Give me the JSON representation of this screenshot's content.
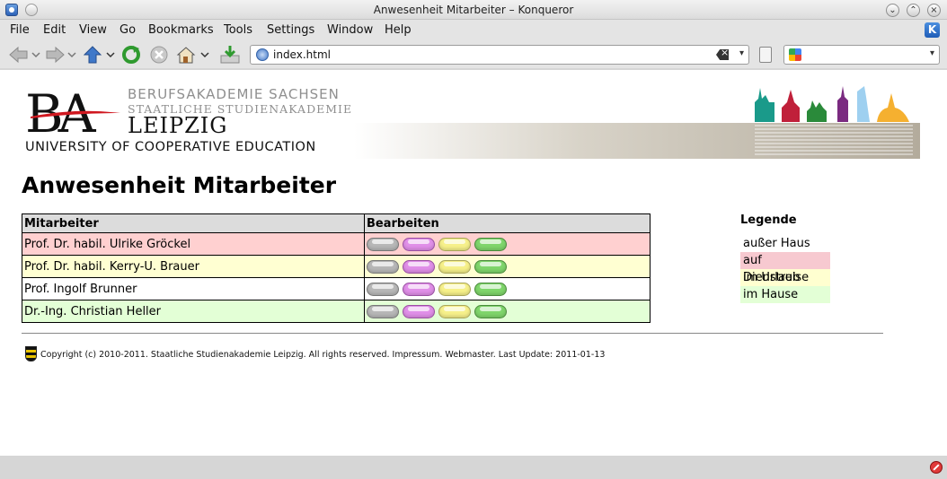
{
  "window": {
    "title": "Anwesenheit Mitarbeiter – Konqueror"
  },
  "menu": [
    {
      "label": "File"
    },
    {
      "label": "Edit"
    },
    {
      "label": "View"
    },
    {
      "label": "Go"
    },
    {
      "label": "Bookmarks"
    },
    {
      "label": "Tools"
    },
    {
      "label": "Settings"
    },
    {
      "label": "Window"
    },
    {
      "label": "Help"
    }
  ],
  "toolbar": {
    "url": "index.html",
    "search_value": "",
    "icons": [
      "back-icon",
      "forward-icon",
      "up-icon",
      "reload-icon",
      "stop-icon",
      "home-icon",
      "download-icon"
    ]
  },
  "banner": {
    "mark": "BA",
    "line1": "BERUFSAKADEMIE SACHSEN",
    "line2": "STAATLICHE STUDIENAKADEMIE",
    "line3": "LEIPZIG",
    "line4": "UNIVERSITY OF COOPERATIVE EDUCATION"
  },
  "page": {
    "title": "Anwesenheit Mitarbeiter",
    "table": {
      "headers": [
        "Mitarbeiter",
        "Bearbeiten"
      ],
      "rows": [
        {
          "name": "Prof. Dr. habil. Ulrike Gröckel",
          "status_color": "#ffd0d0"
        },
        {
          "name": "Prof. Dr. habil. Kerry-U. Brauer",
          "status_color": "#ffffd2"
        },
        {
          "name": "Prof. Ingolf Brunner",
          "status_color": "#ffffff"
        },
        {
          "name": "Dr.-Ing. Christian Heller",
          "status_color": "#e3ffd6"
        }
      ],
      "buttons": [
        "gray",
        "pink",
        "yellow",
        "green"
      ]
    },
    "legend": {
      "title": "Legende",
      "items": [
        {
          "label": "außer Haus",
          "color": "#ffffff"
        },
        {
          "label": "auf Dienstreise",
          "color": "#f7c9d0"
        },
        {
          "label": "im Urlaub",
          "color": "#ffffd0"
        },
        {
          "label": "im Hause",
          "color": "#e3ffd6"
        }
      ]
    },
    "footer": "Copyright (c) 2010-2011. Staatliche Studienakademie Leipzig. All rights reserved. Impressum. Webmaster. Last Update: 2011-01-13"
  }
}
